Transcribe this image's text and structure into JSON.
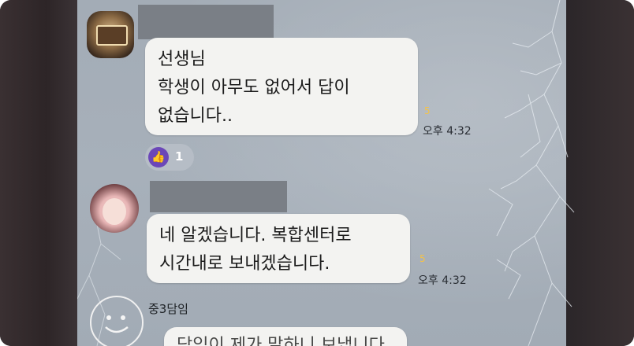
{
  "messages": [
    {
      "lines": [
        "선생님",
        "학생이 아무도 없어서  답이",
        "없습니다.."
      ],
      "unread": "5",
      "time": "오후 4:32",
      "reaction": {
        "icon": "thumbs-up-icon",
        "count": "1"
      }
    },
    {
      "lines": [
        "네 알겠습니다. 복합센터로",
        "시간내로 보내겠습니다."
      ],
      "unread": "5",
      "time": "오후 4:32"
    },
    {
      "sender": "중3담임",
      "lines": [
        "담임이 제가 말하니 보냅니다"
      ]
    }
  ]
}
